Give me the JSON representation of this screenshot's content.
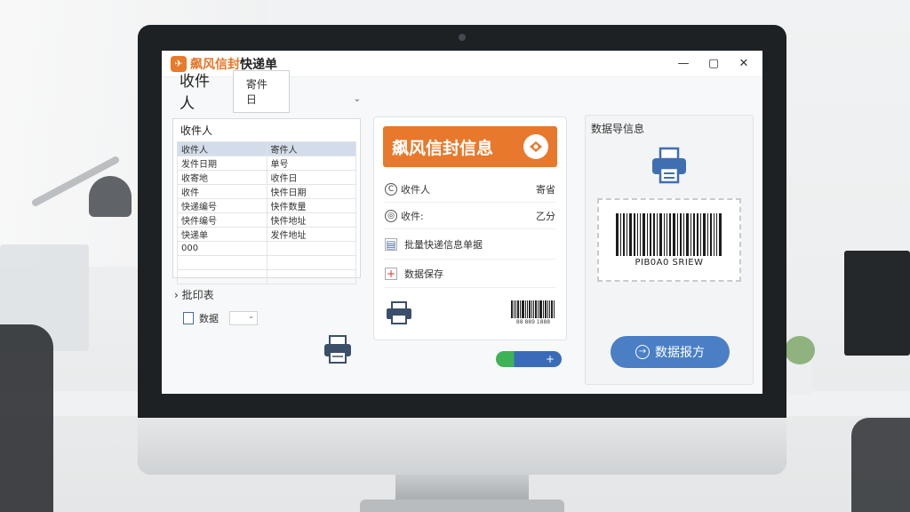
{
  "window": {
    "title_accent": "飙风信封",
    "title_rest": "快递单",
    "minimize": "—",
    "maximize": "▢",
    "close": "✕"
  },
  "left": {
    "tab_active": "收件人",
    "tab_other": "寄件日",
    "list_title": "收件人",
    "rows": [
      [
        "收件人",
        "寄件人"
      ],
      [
        "发件日期",
        "单号"
      ],
      [
        "收寄地",
        "收件日"
      ],
      [
        "收件",
        "快件日期"
      ],
      [
        "快递编号",
        "快件数量"
      ],
      [
        "快件编号",
        "快件地址"
      ],
      [
        "快递单",
        "发件地址"
      ],
      [
        "000",
        ""
      ],
      [
        "",
        ""
      ],
      [
        "",
        ""
      ]
    ],
    "group_label": "批印表",
    "data_label": "数据"
  },
  "middle": {
    "banner": "飙风信封信息",
    "rows": [
      {
        "icon": "C",
        "label": "收件人",
        "value": "寄省"
      },
      {
        "icon": "◎",
        "label": "收件:",
        "value": "乙分"
      }
    ],
    "row3": "批量快递信息单据",
    "row4": "数据保存",
    "barcode_small_text": "88 889 1888",
    "toggle_symbol": "+"
  },
  "right": {
    "title": "数据导信息",
    "barcode_text": "PIB0A0 SRIEW",
    "export_label": "数据报方"
  },
  "colors": {
    "accent_orange": "#e8782b",
    "button_blue": "#4a7fc6",
    "toggle_green": "#3db357"
  }
}
